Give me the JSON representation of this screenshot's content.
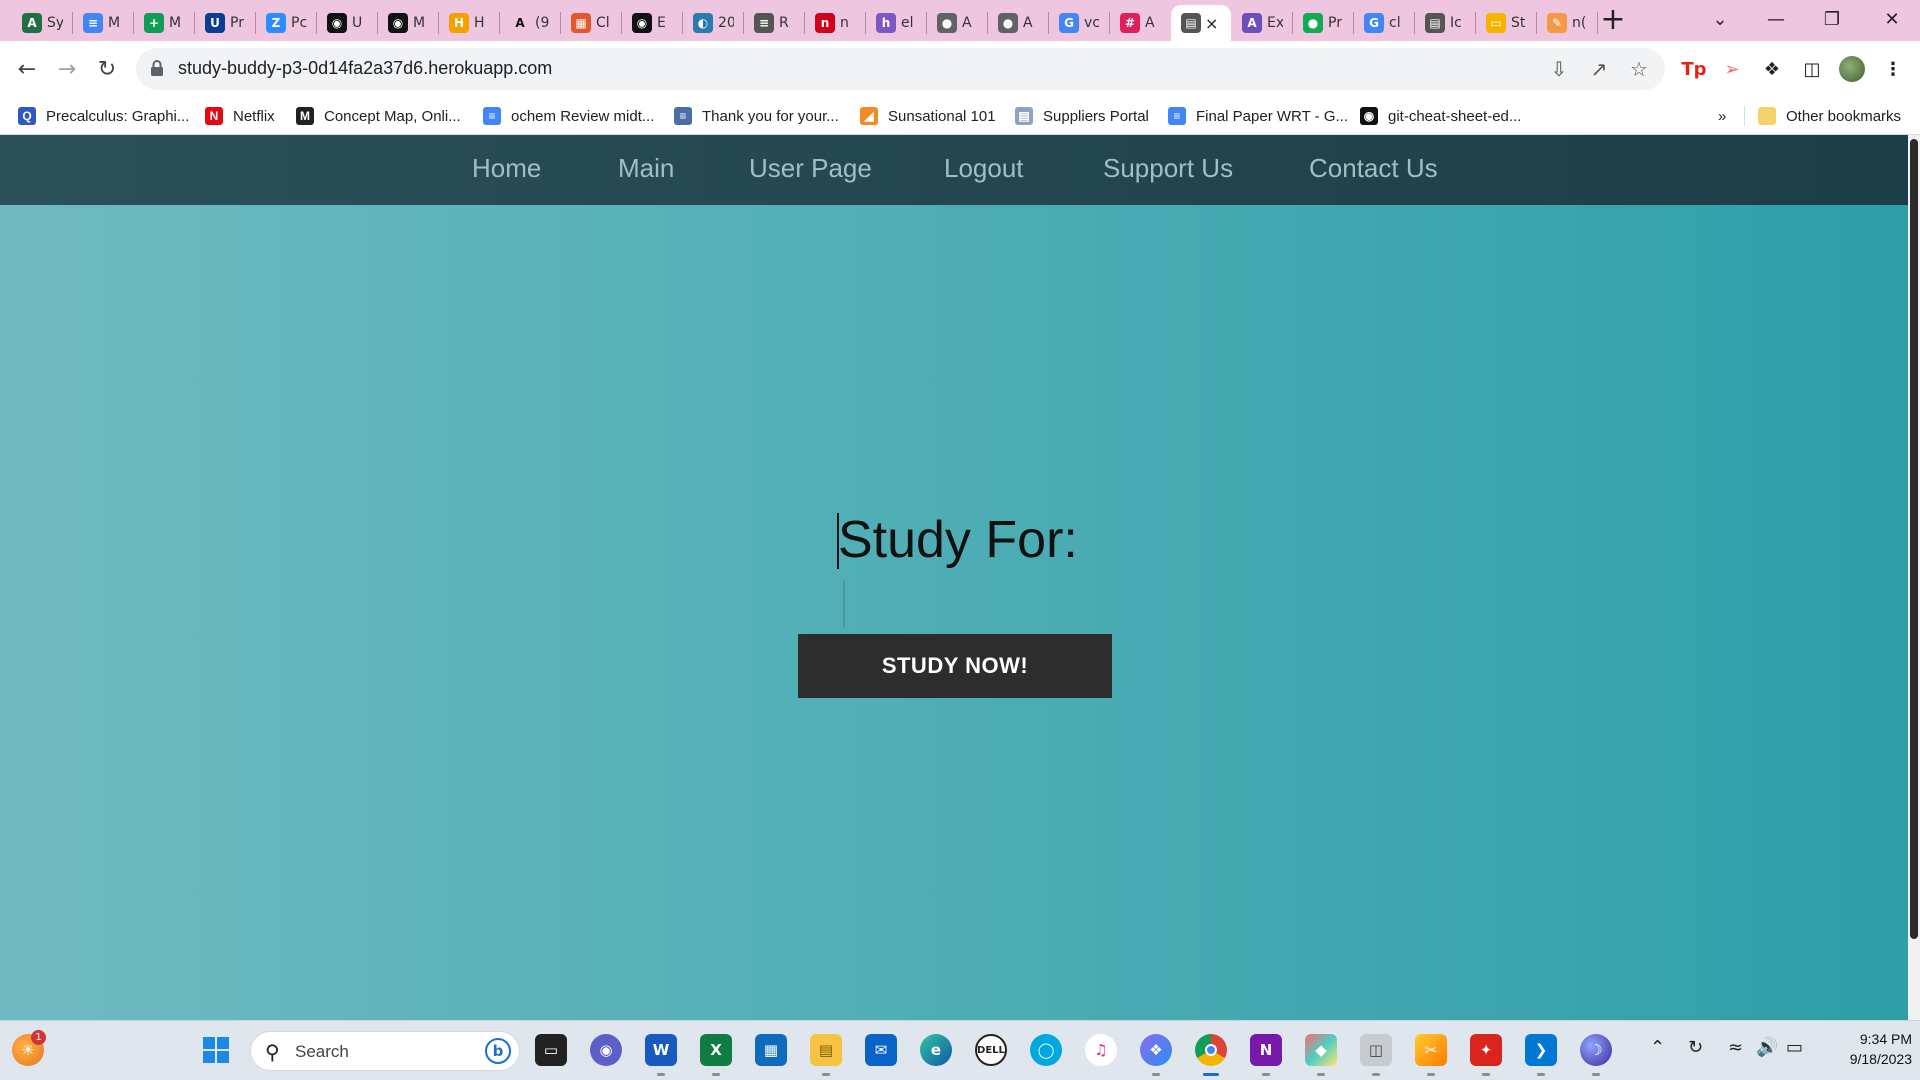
{
  "browser": {
    "tabs": [
      {
        "label": "Sy",
        "icon": "tab-favicon-icon",
        "color": "#1e6e46",
        "glyph": "A"
      },
      {
        "label": "M",
        "icon": "docs-icon",
        "color": "#4285f4",
        "glyph": "≡"
      },
      {
        "label": "M",
        "icon": "sheets-icon",
        "color": "#0f9d58",
        "glyph": "+"
      },
      {
        "label": "Pr",
        "icon": "uci-icon",
        "color": "#0b3d91",
        "glyph": "U"
      },
      {
        "label": "Pc",
        "icon": "zoom-icon",
        "color": "#2d8cff",
        "glyph": "Z"
      },
      {
        "label": "U",
        "icon": "github-icon",
        "color": "#111111",
        "glyph": "◉"
      },
      {
        "label": "M",
        "icon": "github-icon",
        "color": "#111111",
        "glyph": "◉"
      },
      {
        "label": "H",
        "icon": "tab-favicon-icon",
        "color": "#f4a200",
        "glyph": "H"
      },
      {
        "label": "(9",
        "icon": "font-icon",
        "color": "#ffffff",
        "glyph": "A"
      },
      {
        "label": "Cl",
        "icon": "calendar-icon",
        "color": "#e4572e",
        "glyph": "▦"
      },
      {
        "label": "E",
        "icon": "github-icon",
        "color": "#111111",
        "glyph": "◉"
      },
      {
        "label": "20",
        "icon": "tab-favicon-icon",
        "color": "#2a7ab0",
        "glyph": "◐"
      },
      {
        "label": "R",
        "icon": "doc-icon",
        "color": "#555555",
        "glyph": "≡"
      },
      {
        "label": "n",
        "icon": "tab-favicon-icon",
        "color": "#d0021b",
        "glyph": "n"
      },
      {
        "label": "el",
        "icon": "tab-favicon-icon",
        "color": "#7e57c2",
        "glyph": "h"
      },
      {
        "label": "A",
        "icon": "globe-icon",
        "color": "#5f6368",
        "glyph": "●"
      },
      {
        "label": "A",
        "icon": "globe-icon",
        "color": "#5f6368",
        "glyph": "●"
      },
      {
        "label": "vc",
        "icon": "google-icon",
        "color": "#4285f4",
        "glyph": "G"
      },
      {
        "label": "A",
        "icon": "slack-icon",
        "color": "#e01e5a",
        "glyph": "#"
      },
      {
        "label": "",
        "icon": "page-icon",
        "color": "#555555",
        "glyph": "▤",
        "active": true
      },
      {
        "label": "Ex",
        "icon": "tab-favicon-icon",
        "color": "#6b4fbb",
        "glyph": "A"
      },
      {
        "label": "Pr",
        "icon": "mongodb-icon",
        "color": "#13aa52",
        "glyph": "●"
      },
      {
        "label": "cl",
        "icon": "google-icon",
        "color": "#4285f4",
        "glyph": "G"
      },
      {
        "label": "Ic",
        "icon": "page-icon",
        "color": "#555555",
        "glyph": "▤"
      },
      {
        "label": "St",
        "icon": "slides-icon",
        "color": "#f4b400",
        "glyph": "▭"
      },
      {
        "label": "n(",
        "icon": "tab-favicon-icon",
        "color": "#f29a46",
        "glyph": "✎"
      }
    ],
    "url": "study-buddy-p3-0d14fa2a37d6.herokuapp.com",
    "bookmarks": [
      {
        "label": "Precalculus: Graphi...",
        "icon": "desmos-icon",
        "color": "#2f57c9",
        "glyph": "Q"
      },
      {
        "label": "Netflix",
        "icon": "netflix-icon",
        "color": "#e50914",
        "glyph": "N"
      },
      {
        "label": "Concept Map, Onli...",
        "icon": "miro-icon",
        "color": "#222222",
        "glyph": "M"
      },
      {
        "label": "ochem Review midt...",
        "icon": "docs-icon",
        "color": "#4285f4",
        "glyph": "≡"
      },
      {
        "label": "Thank you for your...",
        "icon": "list-icon",
        "color": "#4a6fa5",
        "glyph": "≡"
      },
      {
        "label": "Sunsational 101",
        "icon": "tab-favicon-icon",
        "color": "#f28c28",
        "glyph": "◢"
      },
      {
        "label": "Suppliers Portal",
        "icon": "doc-icon",
        "color": "#8aa4c8",
        "glyph": "▤"
      },
      {
        "label": "Final Paper WRT - G...",
        "icon": "docs-icon",
        "color": "#4285f4",
        "glyph": "≡"
      },
      {
        "label": "git-cheat-sheet-ed...",
        "icon": "github-icon",
        "color": "#111111",
        "glyph": "◉"
      }
    ],
    "bookmarks_overflow": "»",
    "other_bookmarks": "Other bookmarks"
  },
  "site": {
    "nav": [
      "Home",
      "Main",
      "User Page",
      "Logout",
      "Support Us",
      "Contact Us"
    ],
    "heading": "Study For:",
    "input_value": "",
    "button": "STUDY NOW!"
  },
  "taskbar": {
    "search_label": "Search",
    "badge": "1",
    "time": "9:34 PM",
    "date": "9/18/2023"
  }
}
